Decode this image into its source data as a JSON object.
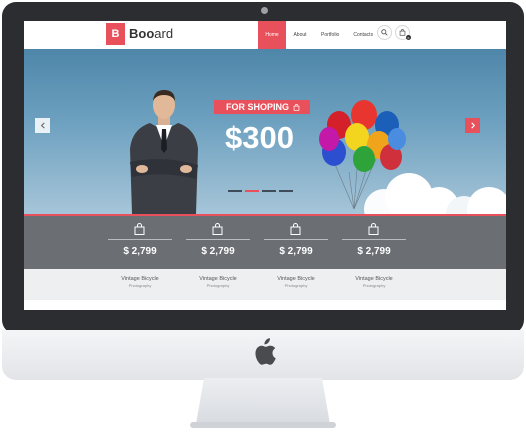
{
  "header": {
    "logo_letter": "B",
    "logo_text_bold": "Boo",
    "logo_text_rest": "ard",
    "nav": [
      {
        "label": "Home"
      },
      {
        "label": "About"
      },
      {
        "label": "Portfolio"
      },
      {
        "label": "Contacts"
      }
    ],
    "cart_count": "0"
  },
  "hero": {
    "promo_label": "FOR SHOPING",
    "price": "$300"
  },
  "products": [
    {
      "price": "$ 2,799",
      "title": "Vintage Bicycle",
      "category": "Photography"
    },
    {
      "price": "$ 2,799",
      "title": "Vintage Bicycle",
      "category": "Photography"
    },
    {
      "price": "$ 2,799",
      "title": "Vintage Bicycle",
      "category": "Photography"
    },
    {
      "price": "$ 2,799",
      "title": "Vintage Bicycle",
      "category": "Photography"
    }
  ],
  "colors": {
    "accent": "#e8505b",
    "monitor": "#2c2d30",
    "product_bar": "#6b6e73"
  }
}
